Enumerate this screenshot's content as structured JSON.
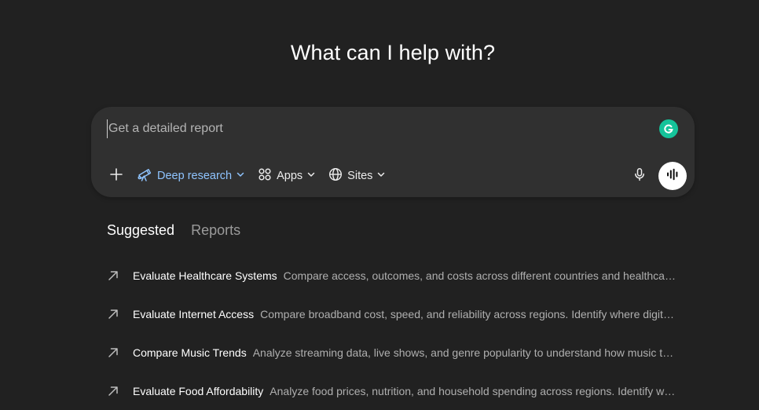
{
  "headline": "What can I help with?",
  "composer": {
    "placeholder": "Get a detailed report",
    "tools": {
      "deep_research": "Deep research",
      "apps": "Apps",
      "sites": "Sites"
    },
    "icons": {
      "add": "plus-icon",
      "deep_research": "telescope-icon",
      "apps": "grid-icon",
      "sites": "globe-icon",
      "mic": "microphone-icon",
      "voice": "voice-waveform-icon",
      "grammarly": "grammarly-icon"
    },
    "accent_color": "#8fc4ff"
  },
  "tabs": [
    {
      "label": "Suggested",
      "selected": true
    },
    {
      "label": "Reports",
      "selected": false
    }
  ],
  "suggestions": [
    {
      "title": "Evaluate Healthcare Systems",
      "description": "Compare access, outcomes, and costs across different countries and healthcare mo..."
    },
    {
      "title": "Evaluate Internet Access",
      "description": "Compare broadband cost, speed, and reliability across regions. Identify where digital ac..."
    },
    {
      "title": "Compare Music Trends",
      "description": "Analyze streaming data, live shows, and genre popularity to understand how music taste..."
    },
    {
      "title": "Evaluate Food Affordability",
      "description": "Analyze food prices, nutrition, and household spending across regions. Identify wher..."
    }
  ]
}
